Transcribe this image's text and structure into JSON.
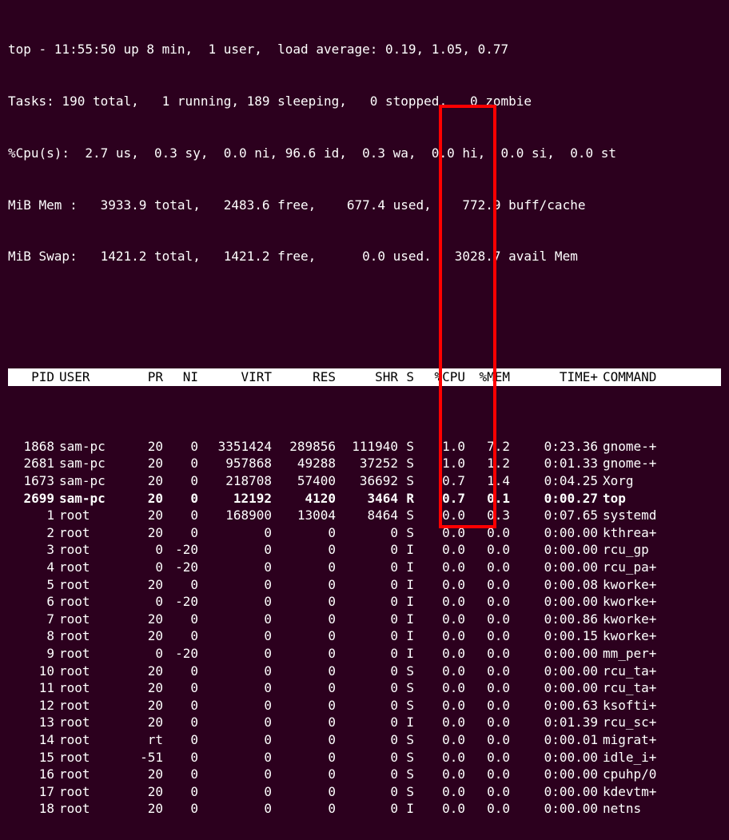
{
  "summary": {
    "line1": "top - 11:55:50 up 8 min,  1 user,  load average: 0.19, 1.05, 0.77",
    "line2": "Tasks: 190 total,   1 running, 189 sleeping,   0 stopped,   0 zombie",
    "line3": "%Cpu(s):  2.7 us,  0.3 sy,  0.0 ni, 96.6 id,  0.3 wa,  0.0 hi,  0.0 si,  0.0 st",
    "line4": "MiB Mem :   3933.9 total,   2483.6 free,    677.4 used,    772.9 buff/cache",
    "line5": "MiB Swap:   1421.2 total,   1421.2 free,      0.0 used.   3028.7 avail Mem"
  },
  "columns": {
    "pid": "PID",
    "user": "USER",
    "pr": "PR",
    "ni": "NI",
    "virt": "VIRT",
    "res": "RES",
    "shr": "SHR",
    "s": "S",
    "cpu": "%CPU",
    "mem": "%MEM",
    "time": "TIME+",
    "cmd": "COMMAND"
  },
  "rows": [
    {
      "pid": "1868",
      "user": "sam-pc",
      "pr": "20",
      "ni": "0",
      "virt": "3351424",
      "res": "289856",
      "shr": "111940",
      "s": "S",
      "cpu": "1.0",
      "mem": "7.2",
      "time": "0:23.36",
      "cmd": "gnome-+",
      "bold": false
    },
    {
      "pid": "2681",
      "user": "sam-pc",
      "pr": "20",
      "ni": "0",
      "virt": "957868",
      "res": "49288",
      "shr": "37252",
      "s": "S",
      "cpu": "1.0",
      "mem": "1.2",
      "time": "0:01.33",
      "cmd": "gnome-+",
      "bold": false
    },
    {
      "pid": "1673",
      "user": "sam-pc",
      "pr": "20",
      "ni": "0",
      "virt": "218708",
      "res": "57400",
      "shr": "36692",
      "s": "S",
      "cpu": "0.7",
      "mem": "1.4",
      "time": "0:04.25",
      "cmd": "Xorg",
      "bold": false
    },
    {
      "pid": "2699",
      "user": "sam-pc",
      "pr": "20",
      "ni": "0",
      "virt": "12192",
      "res": "4120",
      "shr": "3464",
      "s": "R",
      "cpu": "0.7",
      "mem": "0.1",
      "time": "0:00.27",
      "cmd": "top",
      "bold": true
    },
    {
      "pid": "1",
      "user": "root",
      "pr": "20",
      "ni": "0",
      "virt": "168900",
      "res": "13004",
      "shr": "8464",
      "s": "S",
      "cpu": "0.0",
      "mem": "0.3",
      "time": "0:07.65",
      "cmd": "systemd",
      "bold": false
    },
    {
      "pid": "2",
      "user": "root",
      "pr": "20",
      "ni": "0",
      "virt": "0",
      "res": "0",
      "shr": "0",
      "s": "S",
      "cpu": "0.0",
      "mem": "0.0",
      "time": "0:00.00",
      "cmd": "kthrea+",
      "bold": false
    },
    {
      "pid": "3",
      "user": "root",
      "pr": "0",
      "ni": "-20",
      "virt": "0",
      "res": "0",
      "shr": "0",
      "s": "I",
      "cpu": "0.0",
      "mem": "0.0",
      "time": "0:00.00",
      "cmd": "rcu_gp",
      "bold": false
    },
    {
      "pid": "4",
      "user": "root",
      "pr": "0",
      "ni": "-20",
      "virt": "0",
      "res": "0",
      "shr": "0",
      "s": "I",
      "cpu": "0.0",
      "mem": "0.0",
      "time": "0:00.00",
      "cmd": "rcu_pa+",
      "bold": false
    },
    {
      "pid": "5",
      "user": "root",
      "pr": "20",
      "ni": "0",
      "virt": "0",
      "res": "0",
      "shr": "0",
      "s": "I",
      "cpu": "0.0",
      "mem": "0.0",
      "time": "0:00.08",
      "cmd": "kworke+",
      "bold": false
    },
    {
      "pid": "6",
      "user": "root",
      "pr": "0",
      "ni": "-20",
      "virt": "0",
      "res": "0",
      "shr": "0",
      "s": "I",
      "cpu": "0.0",
      "mem": "0.0",
      "time": "0:00.00",
      "cmd": "kworke+",
      "bold": false
    },
    {
      "pid": "7",
      "user": "root",
      "pr": "20",
      "ni": "0",
      "virt": "0",
      "res": "0",
      "shr": "0",
      "s": "I",
      "cpu": "0.0",
      "mem": "0.0",
      "time": "0:00.86",
      "cmd": "kworke+",
      "bold": false
    },
    {
      "pid": "8",
      "user": "root",
      "pr": "20",
      "ni": "0",
      "virt": "0",
      "res": "0",
      "shr": "0",
      "s": "I",
      "cpu": "0.0",
      "mem": "0.0",
      "time": "0:00.15",
      "cmd": "kworke+",
      "bold": false
    },
    {
      "pid": "9",
      "user": "root",
      "pr": "0",
      "ni": "-20",
      "virt": "0",
      "res": "0",
      "shr": "0",
      "s": "I",
      "cpu": "0.0",
      "mem": "0.0",
      "time": "0:00.00",
      "cmd": "mm_per+",
      "bold": false
    },
    {
      "pid": "10",
      "user": "root",
      "pr": "20",
      "ni": "0",
      "virt": "0",
      "res": "0",
      "shr": "0",
      "s": "S",
      "cpu": "0.0",
      "mem": "0.0",
      "time": "0:00.00",
      "cmd": "rcu_ta+",
      "bold": false
    },
    {
      "pid": "11",
      "user": "root",
      "pr": "20",
      "ni": "0",
      "virt": "0",
      "res": "0",
      "shr": "0",
      "s": "S",
      "cpu": "0.0",
      "mem": "0.0",
      "time": "0:00.00",
      "cmd": "rcu_ta+",
      "bold": false
    },
    {
      "pid": "12",
      "user": "root",
      "pr": "20",
      "ni": "0",
      "virt": "0",
      "res": "0",
      "shr": "0",
      "s": "S",
      "cpu": "0.0",
      "mem": "0.0",
      "time": "0:00.63",
      "cmd": "ksofti+",
      "bold": false
    },
    {
      "pid": "13",
      "user": "root",
      "pr": "20",
      "ni": "0",
      "virt": "0",
      "res": "0",
      "shr": "0",
      "s": "I",
      "cpu": "0.0",
      "mem": "0.0",
      "time": "0:01.39",
      "cmd": "rcu_sc+",
      "bold": false
    },
    {
      "pid": "14",
      "user": "root",
      "pr": "rt",
      "ni": "0",
      "virt": "0",
      "res": "0",
      "shr": "0",
      "s": "S",
      "cpu": "0.0",
      "mem": "0.0",
      "time": "0:00.01",
      "cmd": "migrat+",
      "bold": false
    },
    {
      "pid": "15",
      "user": "root",
      "pr": "-51",
      "ni": "0",
      "virt": "0",
      "res": "0",
      "shr": "0",
      "s": "S",
      "cpu": "0.0",
      "mem": "0.0",
      "time": "0:00.00",
      "cmd": "idle_i+",
      "bold": false
    },
    {
      "pid": "16",
      "user": "root",
      "pr": "20",
      "ni": "0",
      "virt": "0",
      "res": "0",
      "shr": "0",
      "s": "S",
      "cpu": "0.0",
      "mem": "0.0",
      "time": "0:00.00",
      "cmd": "cpuhp/0",
      "bold": false
    },
    {
      "pid": "17",
      "user": "root",
      "pr": "20",
      "ni": "0",
      "virt": "0",
      "res": "0",
      "shr": "0",
      "s": "S",
      "cpu": "0.0",
      "mem": "0.0",
      "time": "0:00.00",
      "cmd": "kdevtm+",
      "bold": false
    },
    {
      "pid": "18",
      "user": "root",
      "pr": "20",
      "ni": "0",
      "virt": "0",
      "res": "0",
      "shr": "0",
      "s": "I",
      "cpu": "0.0",
      "mem": "0.0",
      "time": "0:00.00",
      "cmd": "netns",
      "bold": false
    }
  ]
}
